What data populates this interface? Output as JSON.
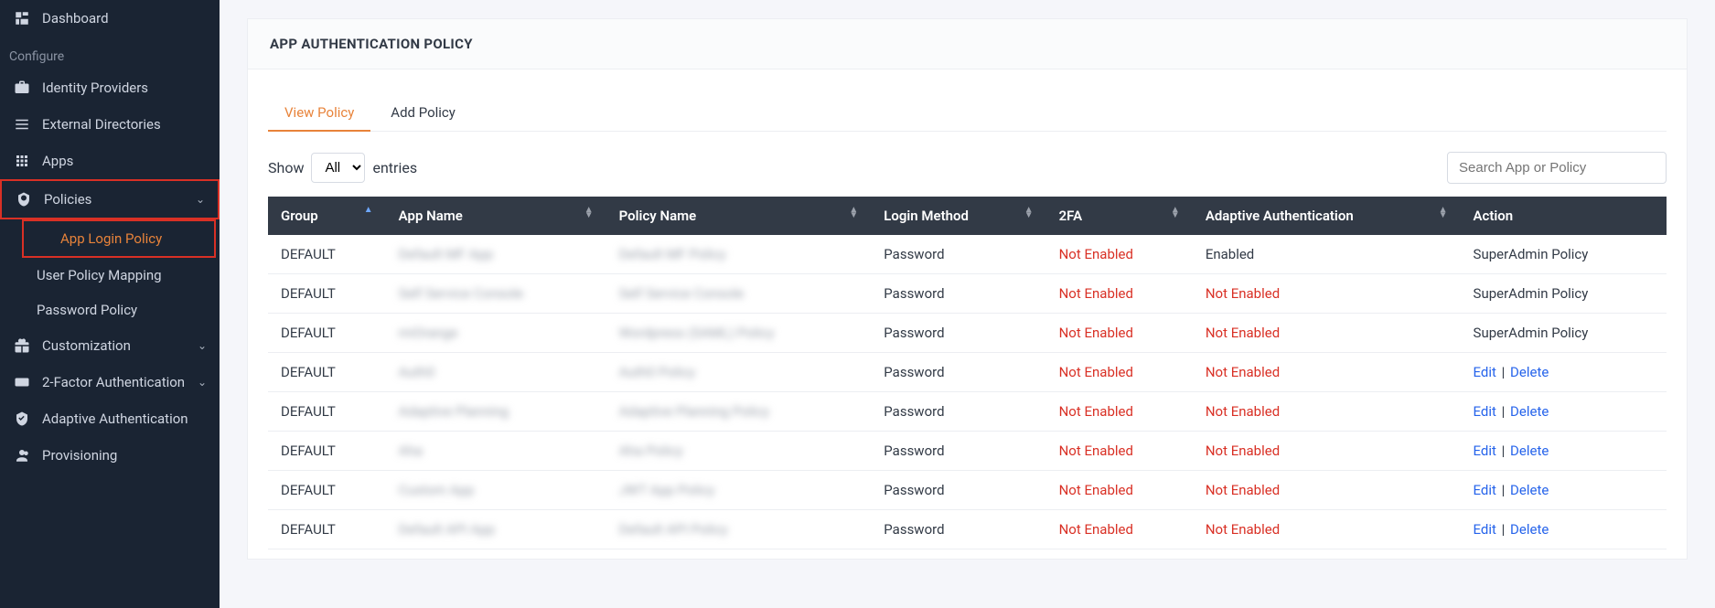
{
  "sidebar": {
    "items": [
      {
        "label": "Dashboard",
        "icon": "dashboard"
      },
      {
        "label": "Configure",
        "section": true
      },
      {
        "label": "Identity Providers",
        "icon": "briefcase"
      },
      {
        "label": "External Directories",
        "icon": "list"
      },
      {
        "label": "Apps",
        "icon": "grid"
      },
      {
        "label": "Policies",
        "icon": "shield",
        "expandable": true,
        "highlighted": true
      },
      {
        "label": "App Login Policy",
        "sub": true,
        "active": true,
        "highlighted": true
      },
      {
        "label": "User Policy Mapping",
        "sub": true
      },
      {
        "label": "Password Policy",
        "sub": true
      },
      {
        "label": "Customization",
        "icon": "gift",
        "expandable": true
      },
      {
        "label": "2-Factor Authentication",
        "icon": "badge-123",
        "expandable": true
      },
      {
        "label": "Adaptive Authentication",
        "icon": "shield-check"
      },
      {
        "label": "Provisioning",
        "icon": "users"
      }
    ]
  },
  "page": {
    "title": "APP AUTHENTICATION POLICY"
  },
  "tabs": {
    "view": "View Policy",
    "add": "Add Policy"
  },
  "controls": {
    "show_label": "Show",
    "entries_label": "entries",
    "show_value": "All",
    "search_placeholder": "Search App or Policy"
  },
  "table": {
    "headers": {
      "group": "Group",
      "app_name": "App Name",
      "policy_name": "Policy Name",
      "login_method": "Login Method",
      "twofa": "2FA",
      "adaptive": "Adaptive Authentication",
      "action": "Action"
    },
    "rows": [
      {
        "group": "DEFAULT",
        "app_name": "Default MF App",
        "policy_name": "Default MF Policy",
        "login_method": "Password",
        "twofa": "Not Enabled",
        "adaptive": "Enabled",
        "action_type": "text",
        "action_text": "SuperAdmin Policy"
      },
      {
        "group": "DEFAULT",
        "app_name": "Self Service Console",
        "policy_name": "Self Service Console",
        "login_method": "Password",
        "twofa": "Not Enabled",
        "adaptive": "Not Enabled",
        "action_type": "text",
        "action_text": "SuperAdmin Policy"
      },
      {
        "group": "DEFAULT",
        "app_name": "miOrange",
        "policy_name": "Wordpress (SAML) Policy",
        "login_method": "Password",
        "twofa": "Not Enabled",
        "adaptive": "Not Enabled",
        "action_type": "text",
        "action_text": "SuperAdmin Policy"
      },
      {
        "group": "DEFAULT",
        "app_name": "Auth0",
        "policy_name": "Auth0 Policy",
        "login_method": "Password",
        "twofa": "Not Enabled",
        "adaptive": "Not Enabled",
        "action_type": "links"
      },
      {
        "group": "DEFAULT",
        "app_name": "Adaptive Planning",
        "policy_name": "Adaptive Planning Policy",
        "login_method": "Password",
        "twofa": "Not Enabled",
        "adaptive": "Not Enabled",
        "action_type": "links"
      },
      {
        "group": "DEFAULT",
        "app_name": "Aha",
        "policy_name": "Aha Policy",
        "login_method": "Password",
        "twofa": "Not Enabled",
        "adaptive": "Not Enabled",
        "action_type": "links"
      },
      {
        "group": "DEFAULT",
        "app_name": "Custom App",
        "policy_name": "JWT App Policy",
        "login_method": "Password",
        "twofa": "Not Enabled",
        "adaptive": "Not Enabled",
        "action_type": "links"
      },
      {
        "group": "DEFAULT",
        "app_name": "Default API App",
        "policy_name": "Default API Policy",
        "login_method": "Password",
        "twofa": "Not Enabled",
        "adaptive": "Not Enabled",
        "action_type": "links"
      }
    ],
    "action_links": {
      "edit": "Edit",
      "delete": "Delete"
    }
  }
}
